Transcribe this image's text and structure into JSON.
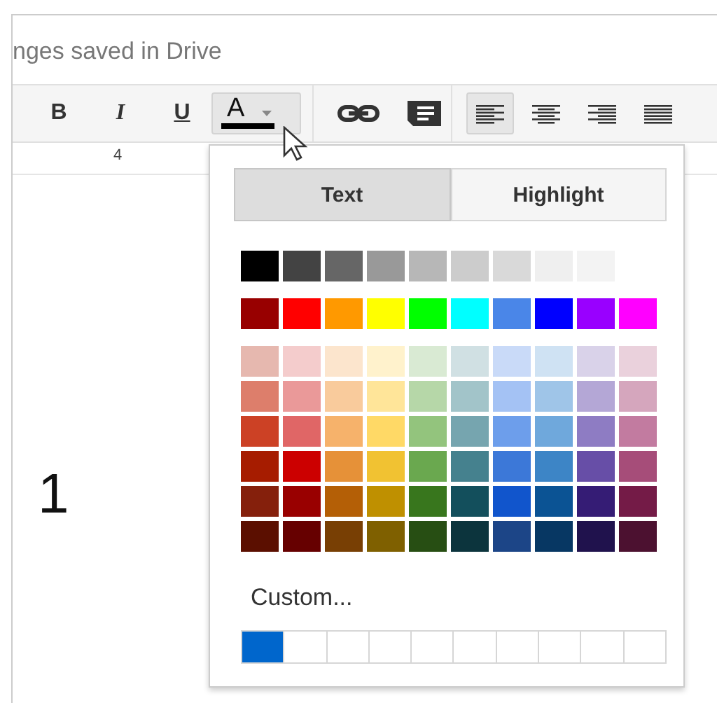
{
  "save_status": "nges saved in Drive",
  "toolbar": [
    {
      "kind": "bold",
      "label": "B",
      "pressed": false
    },
    {
      "kind": "italic",
      "label": "I",
      "pressed": false
    },
    {
      "kind": "underline",
      "label": "U",
      "pressed": false
    },
    {
      "kind": "text_color",
      "label": "A",
      "pressed": true,
      "color": "#000000"
    },
    {
      "kind": "separator"
    },
    {
      "kind": "link",
      "pressed": false
    },
    {
      "kind": "comment",
      "pressed": false
    },
    {
      "kind": "separator"
    },
    {
      "kind": "align_left",
      "pressed": true
    },
    {
      "kind": "align_center",
      "pressed": false
    },
    {
      "kind": "align_right",
      "pressed": false
    },
    {
      "kind": "justify",
      "pressed": false
    }
  ],
  "ruler": {
    "label": "4"
  },
  "document": {
    "text": "1"
  },
  "color_menu": {
    "tabs": [
      {
        "label": "Text",
        "selected": true
      },
      {
        "label": "Highlight",
        "selected": false
      }
    ],
    "rows": [
      [
        {
          "color": "#000000"
        },
        {
          "color": "#434343"
        },
        {
          "color": "#666666"
        },
        {
          "color": "#999999"
        },
        {
          "color": "#b7b7b7"
        },
        {
          "color": "#cccccc"
        },
        {
          "color": "#d9d9d9"
        },
        {
          "color": "#efefef"
        },
        {
          "color": "#f3f3f3"
        }
      ],
      [
        {
          "color": "#980000"
        },
        {
          "color": "#ff0000"
        },
        {
          "color": "#ff9900"
        },
        {
          "color": "#ffff00"
        },
        {
          "color": "#00ff00"
        },
        {
          "color": "#00ffff"
        },
        {
          "color": "#4a86e8"
        },
        {
          "color": "#0000ff"
        },
        {
          "color": "#9900ff"
        },
        {
          "color": "#ff00ff"
        }
      ],
      [
        {
          "color": "#e6b8af"
        },
        {
          "color": "#f4cccc"
        },
        {
          "color": "#fce5cd"
        },
        {
          "color": "#fff2cc"
        },
        {
          "color": "#d9ead3"
        },
        {
          "color": "#d0e0e3"
        },
        {
          "color": "#c9daf8"
        },
        {
          "color": "#cfe2f3"
        },
        {
          "color": "#d9d2e9"
        },
        {
          "color": "#ead1dc"
        }
      ],
      [
        {
          "color": "#dd7e6b"
        },
        {
          "color": "#ea9999"
        },
        {
          "color": "#f9cb9c"
        },
        {
          "color": "#ffe599"
        },
        {
          "color": "#b6d7a8"
        },
        {
          "color": "#a2c4c9"
        },
        {
          "color": "#a4c2f4"
        },
        {
          "color": "#9fc5e8"
        },
        {
          "color": "#b4a7d6"
        },
        {
          "color": "#d5a6bd"
        }
      ],
      [
        {
          "color": "#cc4125"
        },
        {
          "color": "#e06666"
        },
        {
          "color": "#f6b26b"
        },
        {
          "color": "#ffd966"
        },
        {
          "color": "#93c47d"
        },
        {
          "color": "#76a5af"
        },
        {
          "color": "#6d9eeb"
        },
        {
          "color": "#6fa8dc"
        },
        {
          "color": "#8e7cc3"
        },
        {
          "color": "#c27ba0"
        }
      ],
      [
        {
          "color": "#a61c00"
        },
        {
          "color": "#cc0000"
        },
        {
          "color": "#e69138"
        },
        {
          "color": "#f1c232"
        },
        {
          "color": "#6aa84f"
        },
        {
          "color": "#45818e"
        },
        {
          "color": "#3c78d8"
        },
        {
          "color": "#3d85c6"
        },
        {
          "color": "#674ea7"
        },
        {
          "color": "#a64d79"
        }
      ],
      [
        {
          "color": "#85200c"
        },
        {
          "color": "#990000"
        },
        {
          "color": "#b45f06"
        },
        {
          "color": "#bf9000"
        },
        {
          "color": "#38761d"
        },
        {
          "color": "#134f5c"
        },
        {
          "color": "#1155cc"
        },
        {
          "color": "#0b5394"
        },
        {
          "color": "#351c75"
        },
        {
          "color": "#741b47"
        }
      ],
      [
        {
          "color": "#5b0f00"
        },
        {
          "color": "#660000"
        },
        {
          "color": "#783f04"
        },
        {
          "color": "#7f6000"
        },
        {
          "color": "#274e13"
        },
        {
          "color": "#0c343d"
        },
        {
          "color": "#1c4587"
        },
        {
          "color": "#073763"
        },
        {
          "color": "#20124d"
        },
        {
          "color": "#4c1130"
        }
      ]
    ],
    "custom_label": "Custom...",
    "custom_colors": [
      {
        "kind": "color",
        "color": "#0066cc"
      },
      {
        "kind": "empty"
      },
      {
        "kind": "empty"
      },
      {
        "kind": "empty"
      },
      {
        "kind": "empty"
      },
      {
        "kind": "empty"
      },
      {
        "kind": "empty"
      },
      {
        "kind": "empty"
      },
      {
        "kind": "empty"
      },
      {
        "kind": "empty"
      }
    ]
  }
}
